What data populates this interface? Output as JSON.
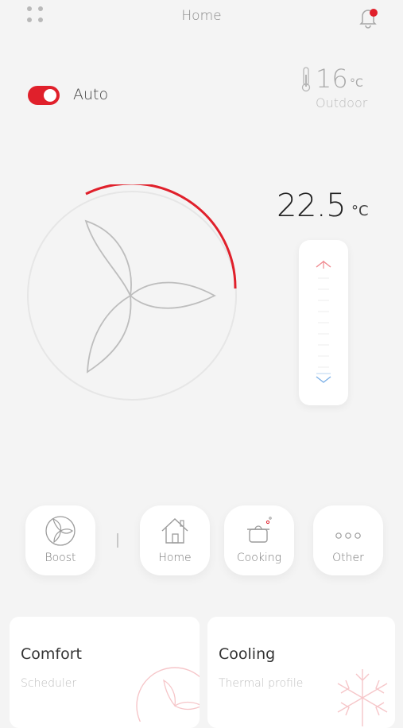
{
  "header": {
    "title": "Home",
    "menu_icon": "grid-dots-icon",
    "bell_icon": "bell-icon",
    "notification_color": "#e0202b"
  },
  "auto": {
    "label": "Auto",
    "on": true,
    "accent": "#e0202b"
  },
  "outdoor": {
    "temperature": "16",
    "unit": "°C",
    "label": "Outdoor"
  },
  "thermostat": {
    "setpoint": "22.5",
    "unit": "°C",
    "plus": "+",
    "minus_icon": "chevron-down-icon"
  },
  "modes": [
    {
      "label": "Boost",
      "icon": "fan-icon"
    },
    {
      "label": "Home",
      "icon": "house-icon"
    },
    {
      "label": "Cooking",
      "icon": "pot-icon"
    },
    {
      "label": "Other",
      "icon": "more-dots-icon"
    }
  ],
  "cards": [
    {
      "title": "Comfort",
      "subtitle": "Scheduler",
      "icon": "fan-icon"
    },
    {
      "title": "Cooling",
      "subtitle": "Thermal profile",
      "icon": "snowflake-icon"
    }
  ]
}
